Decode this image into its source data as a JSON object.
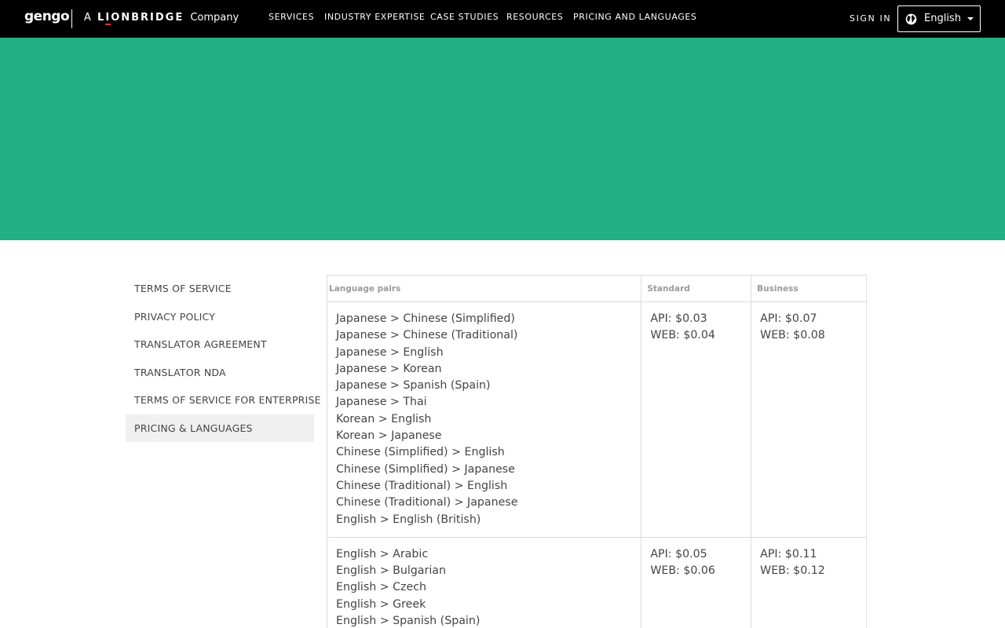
{
  "header": {
    "logo": "gengo",
    "tagline_prefix": "A",
    "tagline_brand": "LIONBRIDGE",
    "tagline_suffix": "Company",
    "nav": [
      "SERVICES",
      "INDUSTRY EXPERTISE",
      "CASE STUDIES",
      "RESOURCES",
      "PRICING AND LANGUAGES"
    ],
    "sign_in": "SIGN IN",
    "language": "English"
  },
  "colors": {
    "hero": "#20b082",
    "topbar": "#000000",
    "brand_accent": "#e4322b"
  },
  "sidebar": {
    "items": [
      "TERMS OF SERVICE",
      "PRIVACY POLICY",
      "TRANSLATOR AGREEMENT",
      "TRANSLATOR NDA",
      "TERMS OF SERVICE FOR ENTERPRISE",
      "PRICING & LANGUAGES"
    ],
    "active": "PRICING & LANGUAGES"
  },
  "table": {
    "headers": [
      "Language pairs",
      "Standard",
      "Business"
    ],
    "rows": [
      {
        "pairs": [
          "Japanese > Chinese (Simplified)",
          "Japanese > Chinese (Traditional)",
          "Japanese > English",
          "Japanese > Korean",
          "Japanese > Spanish (Spain)",
          "Japanese > Thai",
          "Korean > English",
          "Korean > Japanese",
          "Chinese (Simplified) > English",
          "Chinese (Simplified) > Japanese",
          "Chinese (Traditional) > English",
          "Chinese (Traditional) > Japanese",
          "English > English (British)"
        ],
        "standard": [
          "API: $0.03",
          "WEB: $0.04"
        ],
        "business": [
          "API: $0.07",
          "WEB: $0.08"
        ]
      },
      {
        "pairs": [
          "English > Arabic",
          "English > Bulgarian",
          "English > Czech",
          "English > Greek",
          "English > Spanish (Spain)"
        ],
        "standard": [
          "API: $0.05",
          "WEB: $0.06"
        ],
        "business": [
          "API: $0.11",
          "WEB: $0.12"
        ]
      }
    ]
  }
}
